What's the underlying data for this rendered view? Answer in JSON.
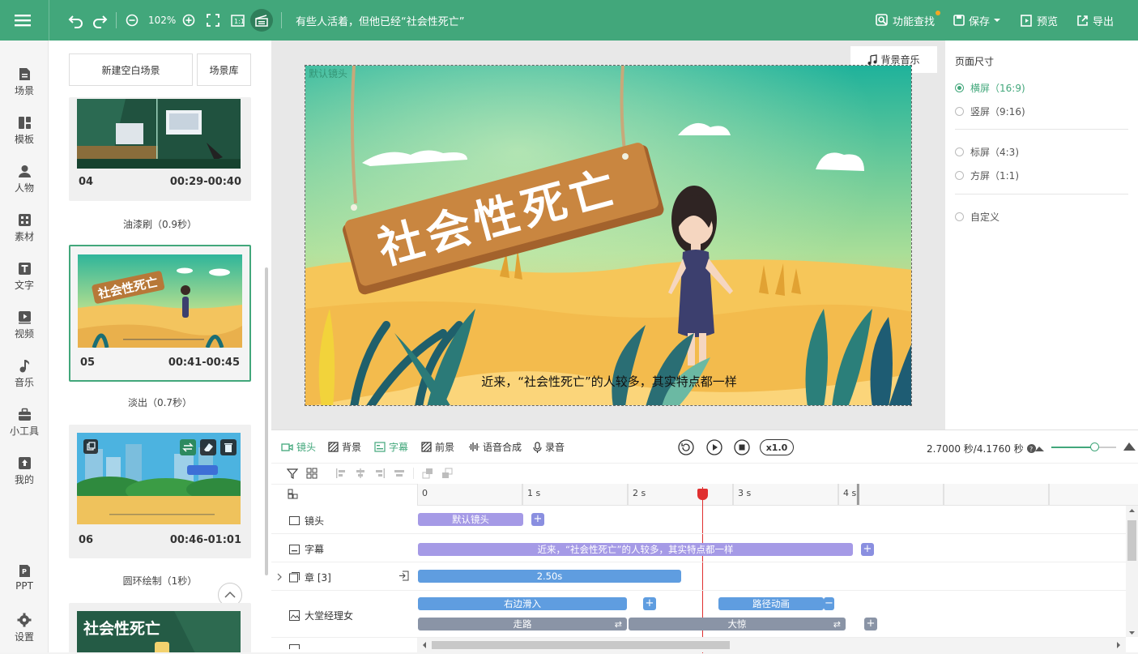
{
  "topbar": {
    "zoom": "102%",
    "title": "有些人活着，但他已经“社会性死亡”",
    "search_label": "功能查找",
    "save_label": "保存",
    "preview_label": "预览",
    "export_label": "导出"
  },
  "leftnav": {
    "items": [
      {
        "label": "场景",
        "icon": "scene-icon"
      },
      {
        "label": "模板",
        "icon": "template-icon"
      },
      {
        "label": "人物",
        "icon": "person-icon"
      },
      {
        "label": "素材",
        "icon": "material-icon"
      },
      {
        "label": "文字",
        "icon": "text-icon"
      },
      {
        "label": "视频",
        "icon": "video-icon"
      },
      {
        "label": "音乐",
        "icon": "music-icon"
      },
      {
        "label": "小工具",
        "icon": "toolbox-icon"
      },
      {
        "label": "我的",
        "icon": "upload-icon"
      }
    ],
    "bottom": [
      {
        "label": "PPT",
        "icon": "ppt-icon"
      },
      {
        "label": "设置",
        "icon": "gear-icon"
      }
    ]
  },
  "scenes": {
    "new_blank": "新建空白场景",
    "library": "场景库",
    "cards": [
      {
        "num": "04",
        "time": "00:29-00:40",
        "transition": "油漆刷（0.9秒）"
      },
      {
        "num": "05",
        "time": "00:41-00:45",
        "transition": "淡出（0.7秒）",
        "sign": "社会性死亡"
      },
      {
        "num": "06",
        "time": "00:46-01:01",
        "transition": "圆环绘制（1秒）"
      },
      {
        "sign": "社会性死亡"
      }
    ]
  },
  "canvas": {
    "default_camera": "默认镜头",
    "bg_music": "背景音乐",
    "sign_text": "社会性死亡",
    "subtitle": "近来，“社会性死亡”的人较多，其实特点都一样"
  },
  "page_size": {
    "title": "页面尺寸",
    "options": [
      {
        "label": "横屏（16:9)",
        "selected": true
      },
      {
        "label": "竖屏（9:16)",
        "selected": false
      },
      {
        "label": "标屏（4:3)",
        "selected": false
      },
      {
        "label": "方屏（1:1)",
        "selected": false
      },
      {
        "label": "自定义",
        "selected": false
      }
    ]
  },
  "timeline": {
    "tabs": [
      "镜头",
      "背景",
      "字幕",
      "前景",
      "语音合成",
      "录音"
    ],
    "speed": "x1.0",
    "time_display": "2.7000 秒/4.1760 秒",
    "ruler_ticks": [
      "0",
      "1 s",
      "2 s",
      "3 s",
      "4 s"
    ],
    "playhead_seconds": 2.7,
    "rows": {
      "camera": {
        "label": "镜头",
        "clip": "默认镜头"
      },
      "subtitle": {
        "label": "字幕",
        "clip": "近来，“社会性死亡”的人较多，其实特点都一样"
      },
      "chapter": {
        "label": "章 [3]",
        "clip": "2.50s"
      },
      "character": {
        "label": "大堂经理女",
        "clips": [
          "右边滑入",
          "路径动画",
          "走路",
          "大惊"
        ]
      }
    }
  },
  "colors": {
    "accent": "#42a77b",
    "clip_blue": "#5f9de0",
    "clip_purple": "#a59ae6",
    "clip_gray": "#8a94a6",
    "playhead": "#e03030"
  }
}
